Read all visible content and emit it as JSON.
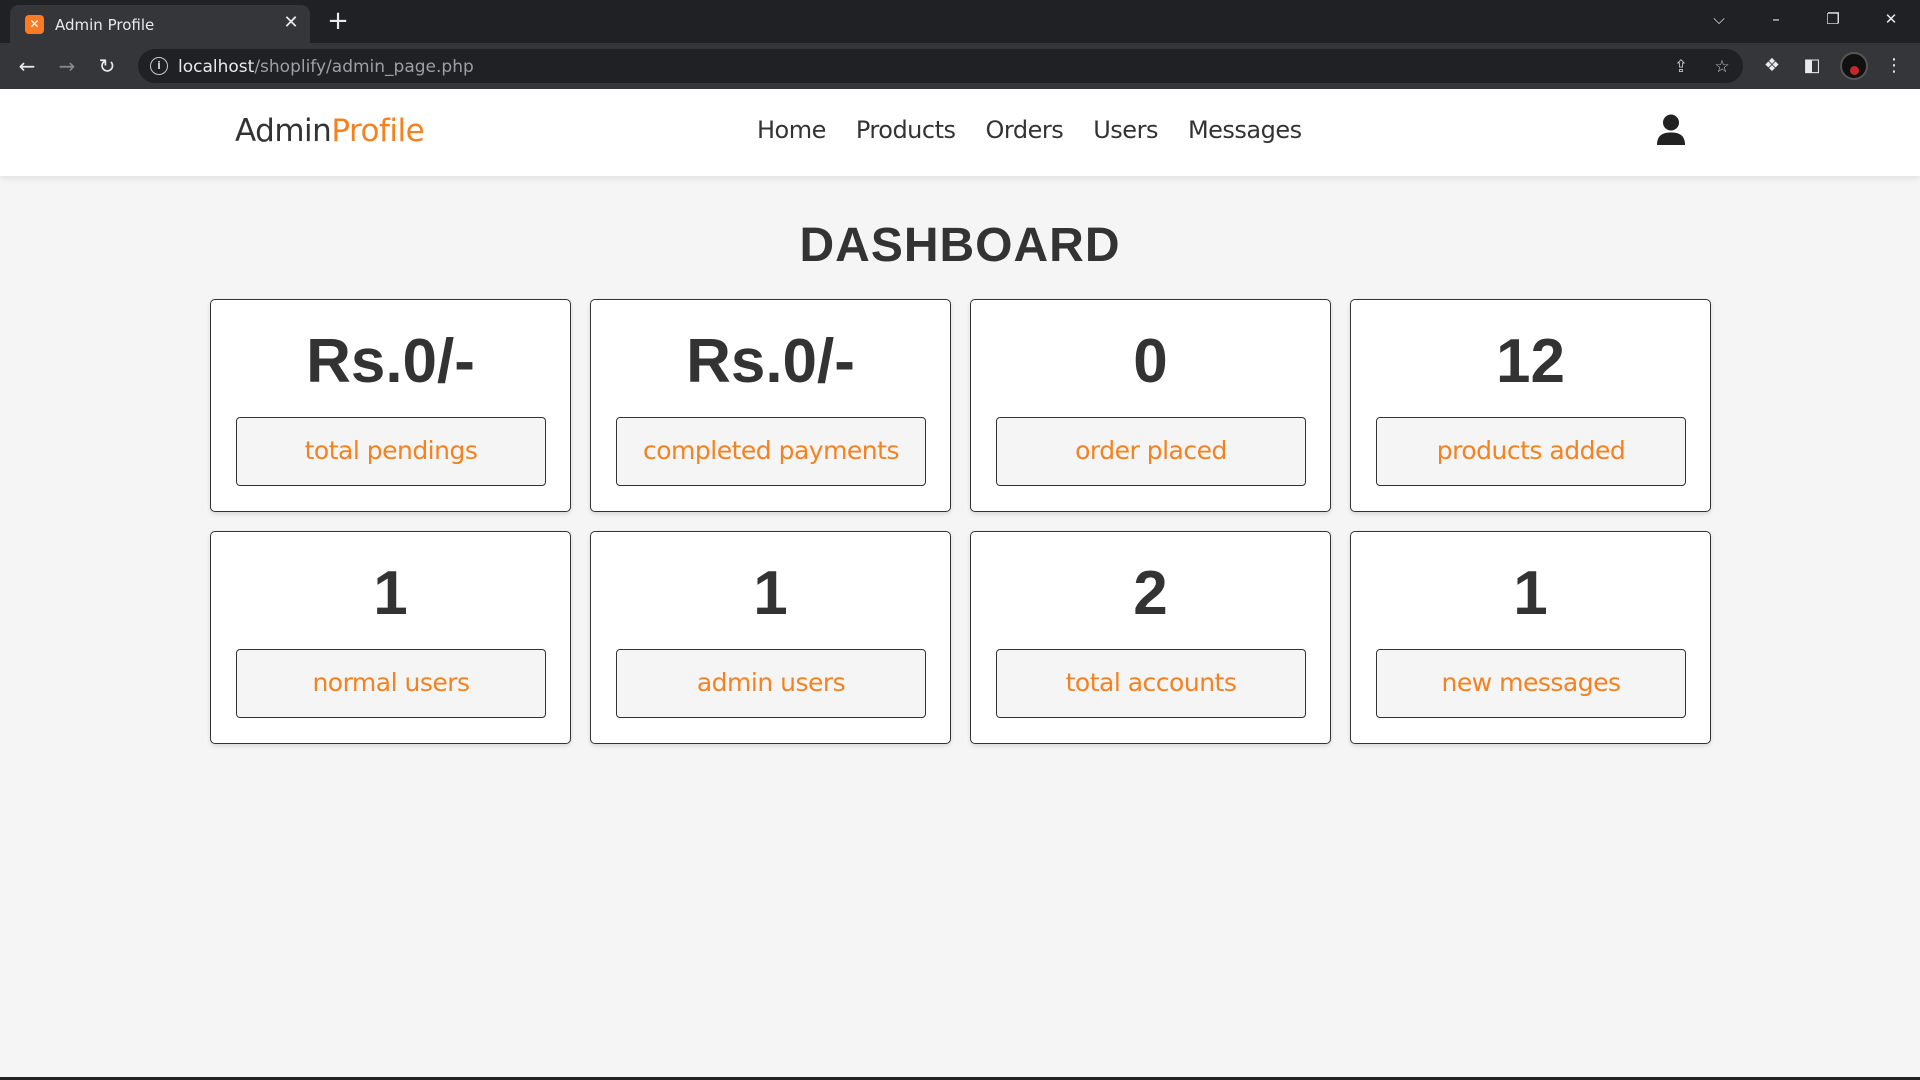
{
  "browser": {
    "tab_title": "Admin Profile",
    "tab_favicon": "xampp-icon",
    "url_host": "localhost",
    "url_path": "/shoplify/admin_page.php"
  },
  "header": {
    "logo_main": "Admin",
    "logo_accent": "Profile",
    "nav": [
      "Home",
      "Products",
      "Orders",
      "Users",
      "Messages"
    ]
  },
  "dashboard": {
    "title": "DASHBOARD",
    "cards": [
      {
        "value": "Rs.0/-",
        "label": "total pendings"
      },
      {
        "value": "Rs.0/-",
        "label": "completed payments"
      },
      {
        "value": "0",
        "label": "order placed"
      },
      {
        "value": "12",
        "label": "products added"
      },
      {
        "value": "1",
        "label": "normal users"
      },
      {
        "value": "1",
        "label": "admin users"
      },
      {
        "value": "2",
        "label": "total accounts"
      },
      {
        "value": "1",
        "label": "new messages"
      }
    ]
  },
  "colors": {
    "accent": "#f5821f",
    "text": "#333333",
    "page_bg": "#f5f5f5"
  }
}
